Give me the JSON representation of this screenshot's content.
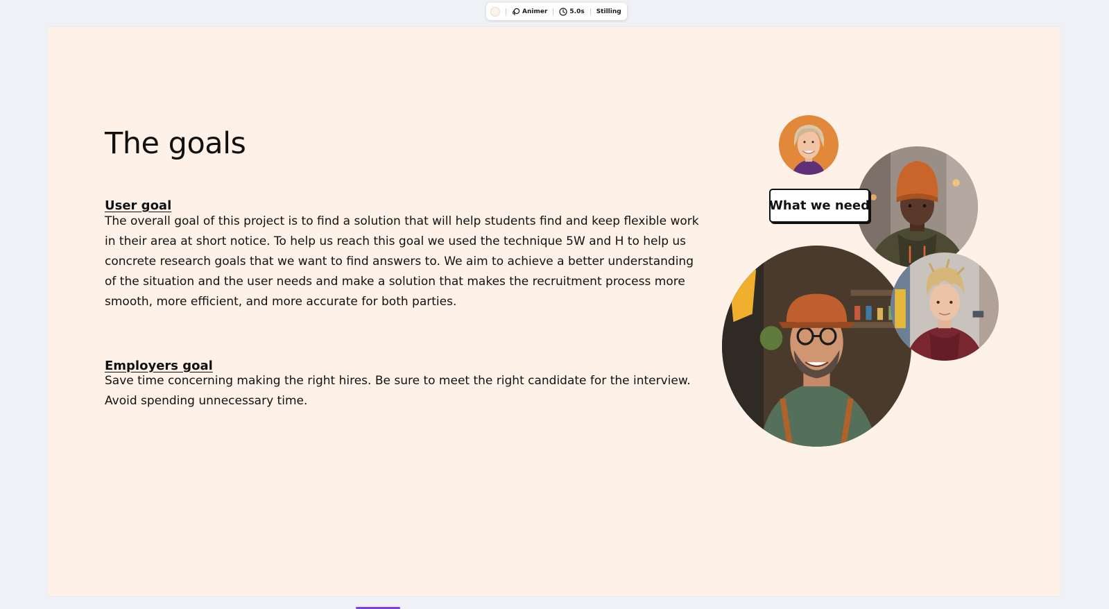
{
  "toolbar": {
    "color_swatch": "#fef2e8",
    "animate_label": "Animer",
    "duration_label": "5.0s",
    "position_label": "Stilling"
  },
  "slide": {
    "background": "#fef2e8",
    "title": "The goals",
    "user_goal": {
      "heading": "User goal",
      "body": "The overall goal of this project is to find a solution that will help students find and keep flexible work in their area at short notice. To help us reach this goal we used the technique 5W and H to help us concrete research goals that we want to find answers to. We aim to achieve a better understanding of the situation and the user needs and make a solution that makes the recruitment process more smooth, more efficient, and more accurate for both parties."
    },
    "employers_goal": {
      "heading": "Employers goal",
      "body": "Save time concerning making the right hires. Be sure to meet the right candidate for the interview. Avoid spending unnecessary time."
    },
    "badge_label": "What we need"
  },
  "icons": {
    "animate": "animate-icon",
    "clock": "clock-icon"
  },
  "colors": {
    "canvas": "#eff1f6",
    "accent": "#7b3fe4",
    "text": "#111111"
  }
}
